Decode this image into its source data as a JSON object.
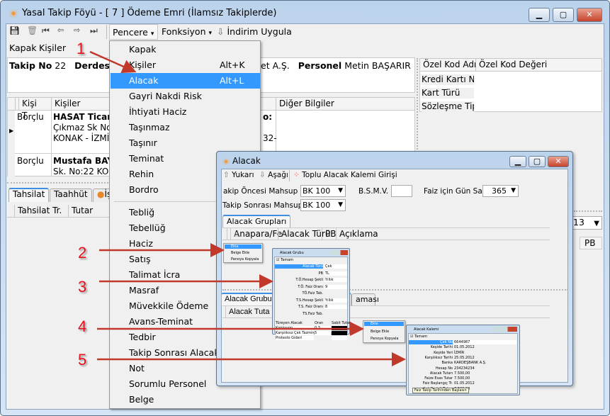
{
  "window": {
    "title": "Yasal Takip Föyü - [ 7 ] Ödeme Emri (İlamsız Takiplerde)",
    "min": "▁",
    "max": "▢",
    "close": "✕"
  },
  "toolbar": {
    "icons": [
      "save-icon",
      "delete-icon",
      "first-icon",
      "prev-icon",
      "next-icon",
      "last-icon"
    ],
    "pencere": "Pencere",
    "fonksiyon": "Fonksiyon",
    "indirim": "İndirim Uygula",
    "dropdown": "▾"
  },
  "nav": {
    "kapak": "Kapak",
    "kisiler": "Kişiler"
  },
  "info": {
    "takip_label": "Takip No",
    "takip_no": "22",
    "status": "Derdest",
    "company_tail": "et A.Ş.",
    "personel_label": "Personel",
    "personel": "Metin BAŞARIR"
  },
  "ozel_kod": {
    "headers": [
      "Özel Kod Adı",
      "Özel Kod Değeri"
    ],
    "rows": [
      "Kredi Kartı No",
      "Kart Türü",
      "Sözleşme Tipi"
    ]
  },
  "persons": {
    "headers": [
      "Kişi T",
      "Kişiler",
      "Diğer Bilgiler"
    ],
    "rows": [
      {
        "type": "Borçlu",
        "name": "HASAT Ticare",
        "line1": "Çıkmaz Sk No:",
        "line2": "KONAK - İZMİR",
        "extra1": "o:",
        "extra2": "32-"
      },
      {
        "type": "Borçlu",
        "name": "Mustafa BAY.",
        "line1": "Sk. No:22 KON"
      }
    ]
  },
  "bottom_tabs": {
    "tabs": [
      "Tahsilat",
      "Taahhüt",
      "İş"
    ],
    "headers": [
      "Tahsilat Tr.",
      "Tutar"
    ]
  },
  "right_behind": {
    "combo": "13",
    "pb": "PB"
  },
  "menu": {
    "items": [
      {
        "label": "Kapak"
      },
      {
        "label": "Kişiler",
        "shortcut": "Alt+K"
      },
      {
        "label": "Alacak",
        "shortcut": "Alt+L",
        "highlighted": true
      },
      {
        "label": "Gayri Nakdi Risk"
      },
      {
        "label": "İhtiyati Haciz"
      },
      {
        "label": "Taşınmaz"
      },
      {
        "label": "Taşınır"
      },
      {
        "label": "Teminat"
      },
      {
        "label": "Rehin"
      },
      {
        "label": "Bordro"
      },
      {
        "label": "Tebliğ"
      },
      {
        "label": "Tebellüğ"
      },
      {
        "label": "Haciz"
      },
      {
        "label": "Satış"
      },
      {
        "label": "Talimat İcra"
      },
      {
        "label": "Masraf"
      },
      {
        "label": "Müvekkile Ödeme",
        "shortcut": "A"
      },
      {
        "label": "Avans-Teminat"
      },
      {
        "label": "Tedbir"
      },
      {
        "label": "Takip Sonrası Alacak"
      },
      {
        "label": "Not"
      },
      {
        "label": "Sorumlu Personel"
      },
      {
        "label": "Belge"
      }
    ]
  },
  "alacak_dialog": {
    "title": "Alacak",
    "yukari": "Yukarı",
    "asagi": "Aşağı",
    "toplu": "Toplu Alacak Kalemi Girişi",
    "f1_label": "akip Öncesi Mahsup Şekli",
    "f1_value": "BK 100",
    "bsmv_label": "B.S.M.V.",
    "bsmv_value": "",
    "gun_label": "Faiz için Gün Sayısı",
    "gun_value": "365",
    "f2_label": "Takip Sonrası Mahsup Şekl",
    "f2_value": "BK 100",
    "tab1": "Alacak Grupları",
    "grid1_headers": [
      "Anapara/Fe",
      "Alacak Türü",
      "PB",
      "Açıklama"
    ],
    "tab2": "Alacak Grubu",
    "tab2_tail": "aması",
    "grid2_headers": [
      "Alacak Tuta"
    ]
  },
  "popup_menu": {
    "items": [
      "Ekle",
      "Belge Ekle",
      "Panoya Kopyala"
    ]
  },
  "alacak_grubu": {
    "title": "Alacak Grubu",
    "tamam": "Tamam",
    "fields": [
      {
        "label": "Alacak Türü",
        "value": "Çek"
      },
      {
        "label": "PB",
        "value": "TL"
      },
      {
        "label": "T.Ö.Hesap Şekli",
        "value": "Yıllık"
      },
      {
        "label": "T.Ö. Faiz Oranı",
        "value": "9"
      },
      {
        "label": "TÖ.Faiz Tab.",
        "value": ""
      },
      {
        "label": "T.S.Hesap Şekli",
        "value": "Yıllık"
      },
      {
        "label": "T.S. Faiz Oranı",
        "value": "8"
      },
      {
        "label": "TS.Faiz Tab.",
        "value": ""
      }
    ],
    "table_headers": [
      "Türeyen Alacak",
      "Oran",
      "Sabit Tutar"
    ],
    "table_rows": [
      {
        "name": "Komisyon",
        "oran": "0,3"
      },
      {
        "name": "Karşılıksız Çek Tazminatı",
        "oran": "5"
      },
      {
        "name": "Protesto Gideri",
        "oran": ""
      }
    ]
  },
  "alacak_kalemi": {
    "title": "Alacak Kalemi",
    "tamam": "Tamam",
    "fields": [
      {
        "label": "Çek No",
        "value": "6644987"
      },
      {
        "label": "Keşide Tarihi",
        "value": "01.05.2012"
      },
      {
        "label": "Keşide Yeri",
        "value": "İZMİR"
      },
      {
        "label": "Karşılıksız Tarihi",
        "value": "25.05.2012"
      },
      {
        "label": "Banka",
        "value": "KARDEŞBANK A.Ş."
      },
      {
        "label": "Hesap No",
        "value": "234234234"
      },
      {
        "label": "Alacak Tutarı",
        "value": "7.500,00"
      },
      {
        "label": "Faize Esas Tutar",
        "value": "7.500,00"
      },
      {
        "label": "Faiz Başlangıç Tr.",
        "value": "01.05.2012"
      },
      {
        "label": "Çek Bedeli Tutarı",
        "value": "7.500,00"
      }
    ],
    "tooltip": "Faiz Takip Tarihinden Başlasın"
  },
  "annotations": {
    "numbers": [
      "1",
      "2",
      "3",
      "4",
      "5"
    ],
    "arrow_color": "#c0392b",
    "number_color": "#e8101a"
  },
  "colors": {
    "highlight": "#3399ff",
    "titlebar": "#c4d9ef"
  }
}
